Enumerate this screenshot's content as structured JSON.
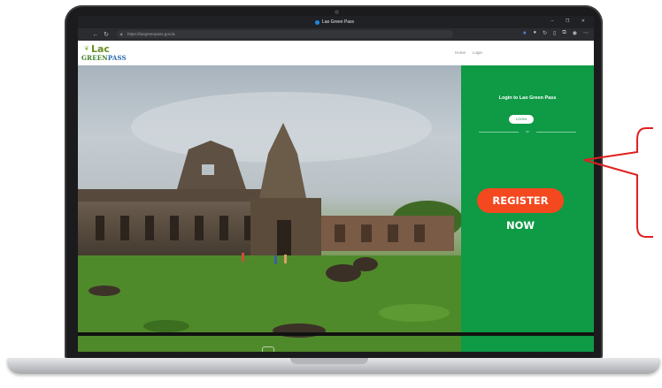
{
  "browser": {
    "tab_title": "Lao Green Pass",
    "url": "https://laogreenpass.gov.la",
    "window_controls": "–  ❐  ✕"
  },
  "site": {
    "logo_word": "Lac",
    "logo_green": "GREEN",
    "logo_pass": "PASS",
    "nav": {
      "home": "Home",
      "login": "Login"
    }
  },
  "panel": {
    "title": "Login to Lao Green Pass",
    "login_button": "LOGIN",
    "divider_text": "or",
    "register_button": "REGISTER NOW"
  },
  "colors": {
    "panel": "#0f9a46",
    "register": "#f4481f",
    "callout": "#e02020"
  },
  "icons": [
    "back-icon",
    "forward-icon",
    "refresh-icon",
    "lock-icon",
    "star-icon",
    "extensions-icon",
    "profile-icon",
    "menu-icon"
  ]
}
